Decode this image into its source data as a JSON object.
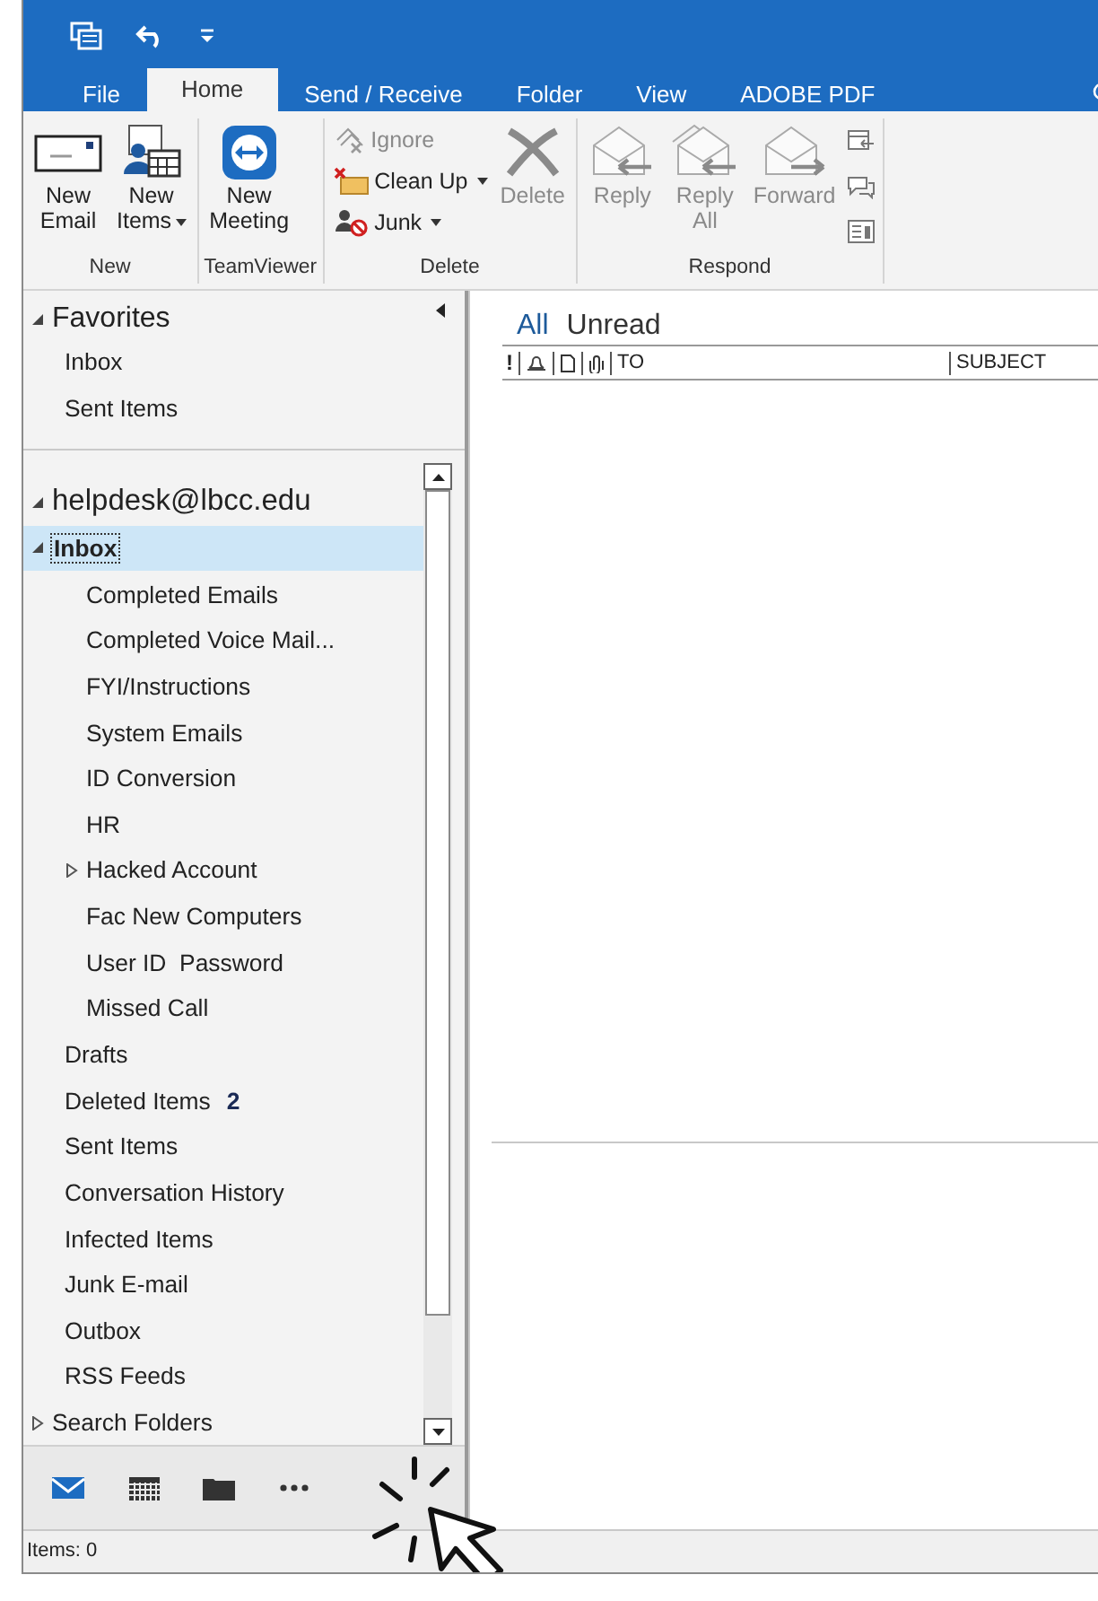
{
  "tabs": [
    {
      "label": "File",
      "selected": false
    },
    {
      "label": "Home",
      "selected": true
    },
    {
      "label": "Send / Receive",
      "selected": false
    },
    {
      "label": "Folder",
      "selected": false
    },
    {
      "label": "View",
      "selected": false
    },
    {
      "label": "ADOBE PDF",
      "selected": false
    }
  ],
  "ribbon": {
    "groups": [
      {
        "label": "New",
        "buttons": [
          {
            "kind": "large",
            "label": "New\nEmail",
            "dropdown": false,
            "disabled": false
          },
          {
            "kind": "large",
            "label": "New\nItems",
            "dropdown": true,
            "disabled": false
          }
        ]
      },
      {
        "label": "TeamViewer",
        "buttons": [
          {
            "kind": "large",
            "label": "New\nMeeting",
            "dropdown": false,
            "disabled": false
          }
        ]
      },
      {
        "label": "Delete",
        "buttons": [
          {
            "kind": "small",
            "label": "Ignore",
            "dropdown": false,
            "disabled": true
          },
          {
            "kind": "small",
            "label": "Clean Up",
            "dropdown": true,
            "disabled": false
          },
          {
            "kind": "small",
            "label": "Junk",
            "dropdown": true,
            "disabled": false
          },
          {
            "kind": "large",
            "label": "Delete",
            "dropdown": false,
            "disabled": true
          }
        ]
      },
      {
        "label": "Respond",
        "buttons": [
          {
            "kind": "large",
            "label": "Reply",
            "dropdown": false,
            "disabled": true
          },
          {
            "kind": "large",
            "label": "Reply\nAll",
            "dropdown": false,
            "disabled": true
          },
          {
            "kind": "large",
            "label": "Forward",
            "dropdown": false,
            "disabled": true
          },
          {
            "kind": "icon",
            "disabled": false
          },
          {
            "kind": "icon",
            "disabled": false
          },
          {
            "kind": "icon",
            "disabled": false
          }
        ]
      }
    ]
  },
  "folders": {
    "favorites": {
      "label": "Favorites",
      "expanded": true,
      "items": [
        {
          "label": "Inbox",
          "selected": false
        },
        {
          "label": "Sent Items",
          "selected": false
        }
      ]
    },
    "account": {
      "label": "helpdesk@lbcc.edu",
      "expanded": true,
      "folders": [
        {
          "label": "Inbox",
          "selected": true,
          "expanded": true,
          "children": [
            {
              "label": "Completed Emails",
              "selected": false
            },
            {
              "label": "Completed Voice Mail...",
              "selected": false
            },
            {
              "label": "FYI/Instructions",
              "selected": false
            },
            {
              "label": "System Emails",
              "selected": false
            },
            {
              "label": "ID Conversion",
              "selected": false
            },
            {
              "label": "HR",
              "selected": false
            },
            {
              "label": "Hacked Account",
              "selected": false,
              "expanded": false
            },
            {
              "label": "Fac New Computers",
              "selected": false
            },
            {
              "label": "User ID  Password",
              "selected": false
            },
            {
              "label": "Missed Call",
              "selected": false
            }
          ]
        },
        {
          "label": "Drafts",
          "selected": false
        },
        {
          "label": "Deleted Items",
          "selected": false,
          "count": "2"
        },
        {
          "label": "Sent Items",
          "selected": false
        },
        {
          "label": "Conversation History",
          "selected": false
        },
        {
          "label": "Infected Items",
          "selected": false
        },
        {
          "label": "Junk E-mail",
          "selected": false
        },
        {
          "label": "Outbox",
          "selected": false
        },
        {
          "label": "RSS Feeds",
          "selected": false
        },
        {
          "label": "Search Folders",
          "selected": false,
          "expanded": false
        }
      ]
    }
  },
  "nav": [
    {
      "selected": true
    },
    {
      "selected": false
    },
    {
      "selected": false
    },
    {
      "selected": false
    }
  ],
  "mail_list": {
    "filters": [
      {
        "label": "All",
        "selected": true
      },
      {
        "label": "Unread",
        "selected": false
      }
    ],
    "columns": [
      {
        "kind": "text",
        "label": "!"
      },
      {
        "kind": "icon"
      },
      {
        "kind": "icon"
      },
      {
        "kind": "icon"
      },
      {
        "kind": "text",
        "label": "TO"
      },
      {
        "kind": "text",
        "label": "SUBJECT"
      }
    ]
  },
  "status_bar": {
    "text": "Items: 0"
  }
}
